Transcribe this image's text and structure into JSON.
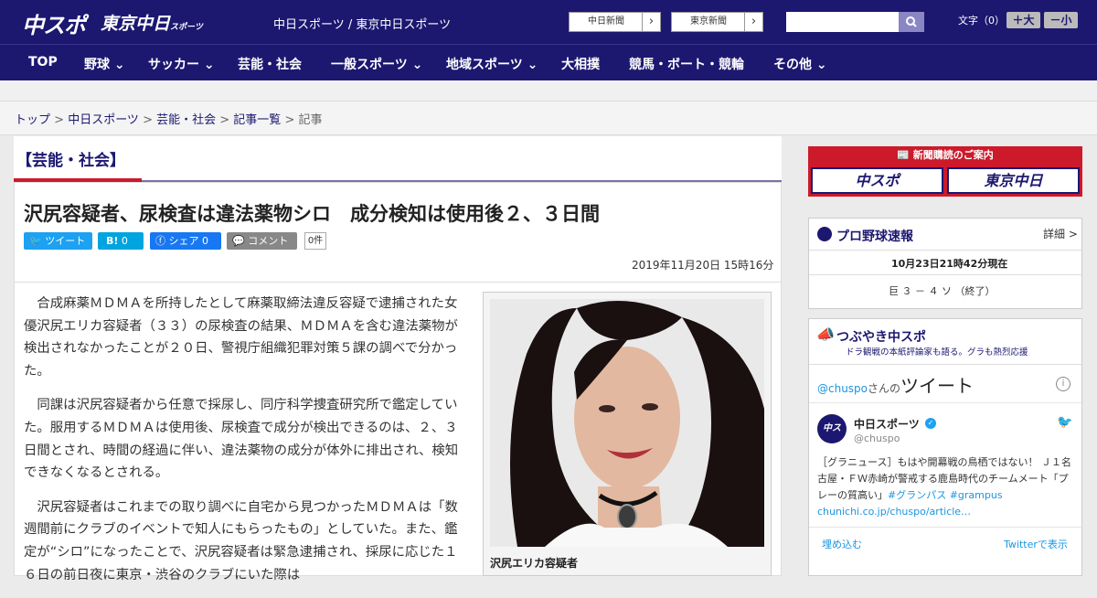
{
  "header": {
    "logo_chuspo": "中スポ",
    "logo_tokyo": "東京中日",
    "logo_tokyo_sub": "スポーツ",
    "site_links": "中日スポーツ / 東京中日スポーツ",
    "btn_chunichi": "中日新聞",
    "btn_tokyo": "東京新聞",
    "search_placeholder": "",
    "font_label": "文字（0）",
    "font_big": "＋大",
    "font_small": "－小"
  },
  "nav": [
    "TOP",
    "野球",
    "サッカー",
    "芸能・社会",
    "一般スポーツ",
    "地域スポーツ",
    "大相撲",
    "競馬・ボート・競輪",
    "その他"
  ],
  "breadcrumb": {
    "items": [
      "トップ",
      "中日スポーツ",
      "芸能・社会",
      "記事一覧"
    ],
    "current": "記事"
  },
  "category": "【芸能・社会】",
  "article": {
    "title": "沢尻容疑者、尿検査は違法薬物シロ　成分検知は使用後２、３日間",
    "share": {
      "tweet": "ツイート",
      "hatena": "B!",
      "hatena_count": "0",
      "facebook": "シェア",
      "facebook_count": "0",
      "comment": "コメント",
      "count": "0件"
    },
    "date": "2019年11月20日 15時16分",
    "paragraphs": [
      "合成麻薬ＭＤＭＡを所持したとして麻薬取締法違反容疑で逮捕された女優沢尻エリカ容疑者（３３）の尿検査の結果、ＭＤＭＡを含む違法薬物が検出されなかったことが２０日、警視庁組織犯罪対策５課の調べで分かった。",
      "同課は沢尻容疑者から任意で採尿し、同庁科学捜査研究所で鑑定していた。服用するＭＤＭＡは使用後、尿検査で成分が検出できるのは、２、３日間とされ、時間の経過に伴い、違法薬物の成分が体外に排出され、検知できなくなるとされる。",
      "沢尻容疑者はこれまでの取り調べに自宅から見つかったＭＤＭＡは「数週間前にクラブのイベントで知人にもらったもの」としていた。また、鑑定が“シロ”になったことで、沢尻容疑者は緊急逮捕され、採尿に応じた１６日の前日夜に東京・渋谷のクラブにいた際は"
    ],
    "photo_caption": "沢尻エリカ容疑者"
  },
  "sidebar": {
    "ad_title": "新聞購読のご案内",
    "ad_chuspo": "中スポ",
    "ad_tokyo": "東京中日",
    "baseball": {
      "title": "プロ野球速報",
      "detail": "詳細 >",
      "time": "10月23日21時42分現在",
      "score": "巨 ３ － ４ ソ （終了）"
    },
    "tweets": {
      "title": "つぶやき中スポ",
      "subtitle": "ドラ観戦の本紙評論家も語る。グラも熱烈応援",
      "handle_line_prefix": "@chuspo",
      "handle_line_mid": "さんの",
      "handle_line_suffix": "ツイート",
      "account_name": "中日スポーツ",
      "account_handle": "@chuspo",
      "tweet_text": "［グラニュース］もはや開幕戦の鳥栖ではない！ Ｊ１名古屋・ＦＷ赤崎が警戒する鹿島時代のチームメート「プレーの質高い」",
      "tweet_tags": "#グランパス #grampus",
      "tweet_link": "chunichi.co.jp/chuspo/article…",
      "embed": "埋め込む",
      "view_on": "Twitterで表示"
    }
  },
  "colors": {
    "brand": "#1c1870",
    "accent": "#cc1a2b",
    "twitter": "#1da1f2",
    "hatena": "#00a4de",
    "facebook": "#1877f2"
  }
}
